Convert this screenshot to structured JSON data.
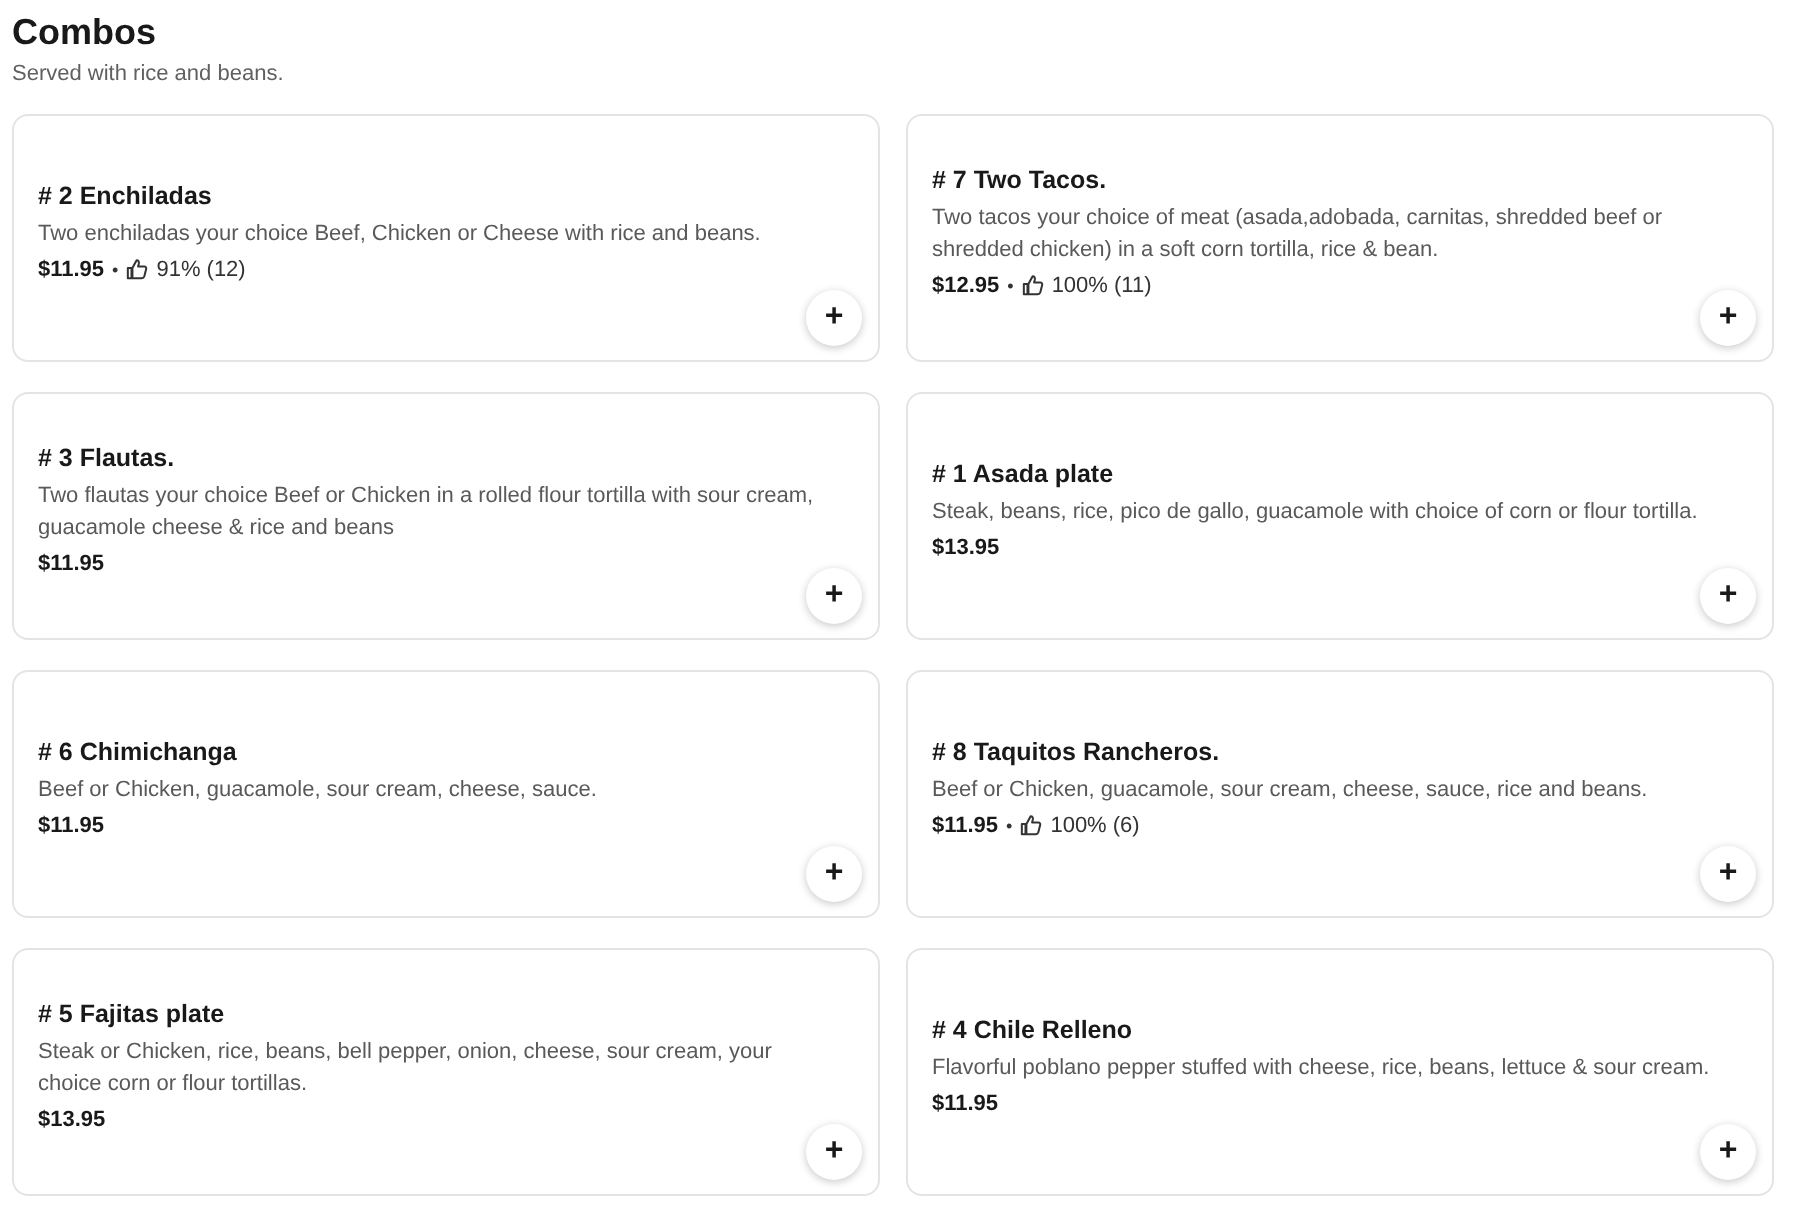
{
  "section": {
    "title": "Combos",
    "subtitle": "Served with rice and beans."
  },
  "items": [
    {
      "name": "# 2 Enchiladas",
      "description": "Two enchiladas your choice Beef, Chicken or Cheese with rice and beans.",
      "price": "$11.95",
      "rating": {
        "separator": "•",
        "text": "91% (12)"
      },
      "add_button": "+"
    },
    {
      "name": "# 3 Flautas.",
      "description": "Two flautas your choice Beef or Chicken in a rolled flour tortilla with sour cream, guacamole cheese & rice and beans",
      "price": "$11.95",
      "add_button": "+"
    },
    {
      "name": "# 6 Chimichanga",
      "description": "Beef or Chicken, guacamole, sour cream, cheese, sauce.",
      "price": "$11.95",
      "add_button": "+"
    },
    {
      "name": "# 5 Fajitas plate",
      "description": "Steak or Chicken, rice, beans, bell pepper, onion, cheese, sour cream, your choice corn or flour tortillas.",
      "price": "$13.95",
      "add_button": "+"
    },
    {
      "name": "# 7 Two Tacos.",
      "description": "Two tacos your choice of meat (asada,adobada, carnitas, shredded beef or shredded chicken) in a soft corn tortilla, rice & bean.",
      "price": "$12.95",
      "rating": {
        "separator": "•",
        "text": "100% (11)"
      },
      "add_button": "+"
    },
    {
      "name": "# 1 Asada plate",
      "description": "Steak, beans, rice, pico de gallo, guacamole with choice of corn or flour tortilla.",
      "price": "$13.95",
      "add_button": "+"
    },
    {
      "name": "# 8 Taquitos Rancheros.",
      "description": "Beef or Chicken, guacamole, sour cream, cheese, sauce, rice and beans.",
      "price": "$11.95",
      "rating": {
        "separator": "•",
        "text": "100% (6)"
      },
      "add_button": "+"
    },
    {
      "name": "# 4 Chile Relleno",
      "description": "Flavorful poblano pepper stuffed with cheese, rice, beans, lettuce & sour cream.",
      "price": "$11.95",
      "add_button": "+"
    }
  ]
}
